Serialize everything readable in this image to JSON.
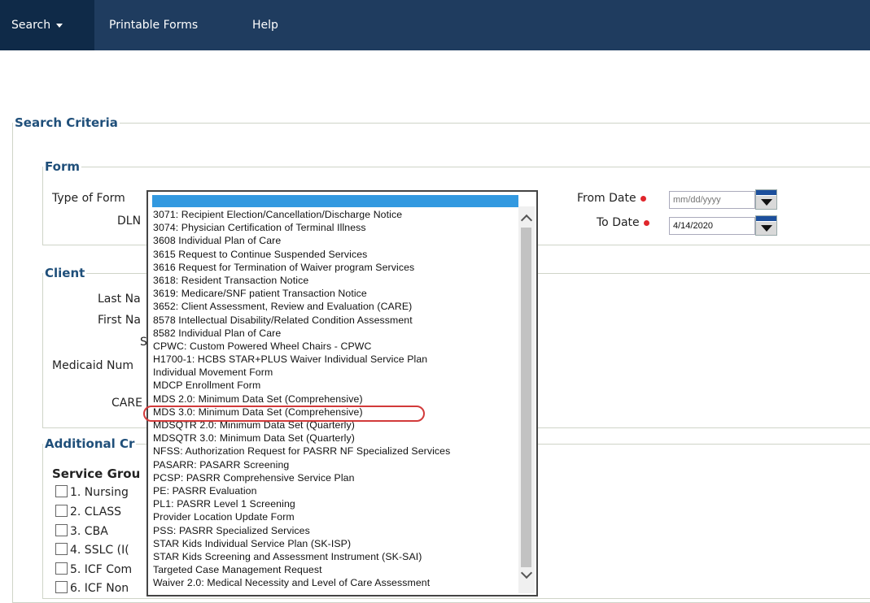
{
  "nav": {
    "search_label": "Search",
    "printable_label": "Printable Forms",
    "help_label": "Help"
  },
  "criteria": {
    "legend": "Search Criteria",
    "form": {
      "legend": "Form",
      "type_of_form_label": "Type of Form",
      "dln_label": "DLN",
      "from_date_label": "From Date",
      "from_date_placeholder": "mm/dd/yyyy",
      "to_date_label": "To Date",
      "to_date_value": "4/14/2020"
    },
    "client": {
      "legend": "Client",
      "last_name_label": "Last Na",
      "first_name_label": "First Na",
      "s_label": "S",
      "medicaid_label": "Medicaid Num",
      "care_label": "CARE"
    },
    "additional": {
      "legend": "Additional Cr",
      "service_group_label": "Service Grou",
      "checkboxes": [
        "1. Nursing",
        "2. CLASS",
        "3. CBA",
        "4. SSLC (I(",
        "5. ICF Com",
        "6. ICF Non"
      ]
    }
  },
  "dropdown": {
    "selected": "",
    "options": [
      "3071: Recipient Election/Cancellation/Discharge Notice",
      "3074: Physician Certification of Terminal Illness",
      "3608 Individual Plan of Care",
      "3615 Request to Continue Suspended Services",
      "3616 Request for Termination of Waiver program Services",
      "3618: Resident Transaction Notice",
      "3619: Medicare/SNF patient Transaction Notice",
      "3652: Client Assessment, Review and Evaluation (CARE)",
      "8578 Intellectual Disability/Related Condition Assessment",
      "8582 Individual Plan of Care",
      "CPWC: Custom Powered Wheel Chairs - CPWC",
      "H1700-1: HCBS STAR+PLUS Waiver Individual Service Plan",
      "Individual Movement Form",
      "MDCP Enrollment Form",
      "MDS 2.0: Minimum Data Set (Comprehensive)",
      "MDS 3.0: Minimum Data Set (Comprehensive)",
      "MDSQTR 2.0: Minimum Data Set (Quarterly)",
      "MDSQTR 3.0: Minimum Data Set (Quarterly)",
      "NFSS: Authorization Request for PASRR NF Specialized Services",
      "PASARR: PASARR Screening",
      "PCSP: PASRR Comprehensive Service Plan",
      "PE: PASRR Evaluation",
      "PL1: PASRR Level 1 Screening",
      "Provider Location Update Form",
      "PSS: PASRR Specialized Services",
      "STAR Kids Individual Service Plan (SK-ISP)",
      "STAR Kids Screening and Assessment Instrument (SK-SAI)",
      "Targeted Case Management Request",
      "Waiver 2.0: Medical Necessity and Level of Care Assessment"
    ]
  },
  "colors": {
    "nav_bg": "#1f3c5f",
    "nav_active_bg": "#0f2a48",
    "legend_text": "#1f4f7a",
    "selection": "#3299e0",
    "annotation_ring": "#d23a3a",
    "required_dot": "#e0262c"
  },
  "icons": [
    "chevron-down-icon",
    "calendar-icon",
    "scroll-up-icon",
    "scroll-down-icon",
    "required-dot-icon"
  ]
}
